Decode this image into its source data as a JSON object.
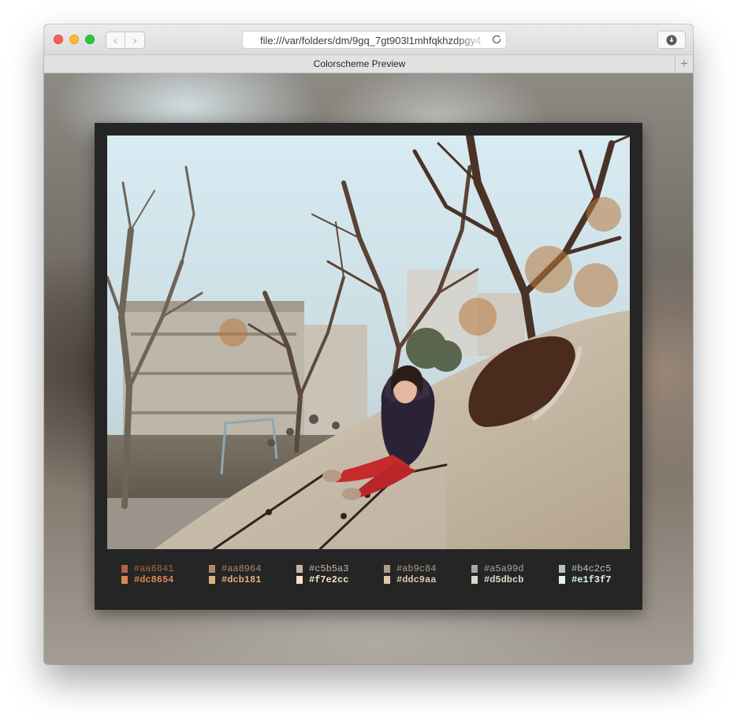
{
  "browser": {
    "url": "file:///var/folders/dm/9gq_7gt903l1mhfqkhzdpgy4",
    "tab_title": "Colorscheme Preview",
    "new_tab_label": "+",
    "back_label": "‹",
    "forward_label": "›"
  },
  "palette": {
    "normal": [
      {
        "hex": "#aa6841",
        "color": "#aa6841"
      },
      {
        "hex": "#aa8964",
        "color": "#aa8964"
      },
      {
        "hex": "#c5b5a3",
        "color": "#c5b5a3"
      },
      {
        "hex": "#ab9c84",
        "color": "#ab9c84"
      },
      {
        "hex": "#a5a99d",
        "color": "#a5a99d"
      },
      {
        "hex": "#b4c2c5",
        "color": "#b4c2c5"
      }
    ],
    "bright": [
      {
        "hex": "#dc8654",
        "color": "#dc8654"
      },
      {
        "hex": "#dcb181",
        "color": "#dcb181"
      },
      {
        "hex": "#f7e2cc",
        "color": "#f7e2cc"
      },
      {
        "hex": "#ddc9aa",
        "color": "#ddc9aa"
      },
      {
        "hex": "#d5dbcb",
        "color": "#d5dbcb"
      },
      {
        "hex": "#e1f3f7",
        "color": "#e1f3f7"
      }
    ]
  },
  "icons": {
    "reload": "reload-icon",
    "download": "download-icon",
    "photo": "photo-girl-on-playground-dome"
  }
}
